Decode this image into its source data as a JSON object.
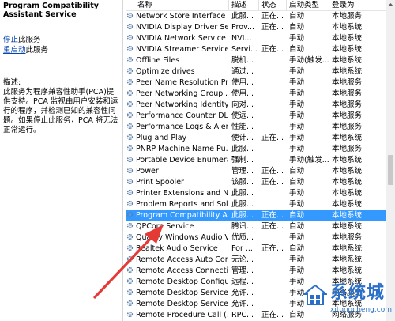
{
  "left_pane": {
    "service_title": "Program Compatibility Assistant Service",
    "actions": [
      {
        "link": "停止",
        "suffix": "此服务"
      },
      {
        "link": "重启动",
        "suffix": "此服务"
      }
    ],
    "description_label": "描述:",
    "description_text": "此服务为程序兼容性助手(PCA)提供支持。PCA 监视由用户安装和运行的程序，并检测已知的兼容性问题。如果停止此服务，PCA 将无法正常运行。"
  },
  "columns": {
    "name": "名称",
    "description": "描述",
    "status": "状态",
    "startup_type": "启动类型",
    "logon_as": "登录为"
  },
  "services": [
    {
      "name": "Network Store Interface ...",
      "description": "此服...",
      "status": "正在...",
      "startup": "自动",
      "logon": "本地服务"
    },
    {
      "name": "NVIDIA Display Driver Se...",
      "description": "Prov...",
      "status": "正在...",
      "startup": "自动",
      "logon": "本地系统"
    },
    {
      "name": "NVIDIA Network Service",
      "description": "NVI...",
      "status": "",
      "startup": "手动",
      "logon": "本地系统"
    },
    {
      "name": "NVIDIA Streamer Service",
      "description": "Servi...",
      "status": "正在...",
      "startup": "自动",
      "logon": "本地系统"
    },
    {
      "name": "Offline Files",
      "description": "脱机...",
      "status": "",
      "startup": "手动(触发...",
      "logon": "本地系统"
    },
    {
      "name": "Optimize drives",
      "description": "通过...",
      "status": "",
      "startup": "手动",
      "logon": "本地系统"
    },
    {
      "name": "Peer Name Resolution Pr...",
      "description": "使用...",
      "status": "",
      "startup": "手动",
      "logon": "本地服务"
    },
    {
      "name": "Peer Networking Groupi...",
      "description": "使用...",
      "status": "",
      "startup": "手动",
      "logon": "本地服务"
    },
    {
      "name": "Peer Networking Identity...",
      "description": "向对...",
      "status": "",
      "startup": "手动",
      "logon": "本地服务"
    },
    {
      "name": "Performance Counter DL...",
      "description": "使远...",
      "status": "",
      "startup": "手动",
      "logon": "本地服务"
    },
    {
      "name": "Performance Logs & Aler...",
      "description": "性能...",
      "status": "",
      "startup": "手动",
      "logon": "本地服务"
    },
    {
      "name": "Plug and Play",
      "description": "使计...",
      "status": "正在...",
      "startup": "手动",
      "logon": "本地系统"
    },
    {
      "name": "PNRP Machine Name Pu...",
      "description": "此服...",
      "status": "",
      "startup": "手动",
      "logon": "本地服务"
    },
    {
      "name": "Portable Device Enumera...",
      "description": "强制...",
      "status": "",
      "startup": "手动(触发...",
      "logon": "本地系统"
    },
    {
      "name": "Power",
      "description": "管理...",
      "status": "正在...",
      "startup": "自动",
      "logon": "本地系统"
    },
    {
      "name": "Print Spooler",
      "description": "该服...",
      "status": "正在...",
      "startup": "自动",
      "logon": "本地系统"
    },
    {
      "name": "Printer Extensions and N...",
      "description": "此服...",
      "status": "",
      "startup": "手动",
      "logon": "本地系统"
    },
    {
      "name": "Problem Reports and Sol...",
      "description": "此服...",
      "status": "",
      "startup": "手动",
      "logon": "本地系统"
    },
    {
      "name": "Program Compatibility A...",
      "description": "此服...",
      "status": "正在...",
      "startup": "自动",
      "logon": "本地系统",
      "selected": true
    },
    {
      "name": "QPCore Service",
      "description": "腾讯...",
      "status": "正在...",
      "startup": "自动",
      "logon": "本地系统"
    },
    {
      "name": "Quality Windows Audio V...",
      "description": "优质...",
      "status": "",
      "startup": "手动",
      "logon": "本地服务"
    },
    {
      "name": "Realtek Audio Service",
      "description": "For ...",
      "status": "正在...",
      "startup": "自动",
      "logon": "本地系统"
    },
    {
      "name": "Remote Access Auto Con...",
      "description": "无论...",
      "status": "",
      "startup": "手动",
      "logon": "本地系统"
    },
    {
      "name": "Remote Access Connecti...",
      "description": "管理...",
      "status": "",
      "startup": "手动",
      "logon": "本地系统"
    },
    {
      "name": "Remote Desktop Configu...",
      "description": "远程...",
      "status": "",
      "startup": "手动",
      "logon": "本地系统"
    },
    {
      "name": "Remote Desktop Services",
      "description": "允许...",
      "status": "",
      "startup": "手动",
      "logon": "网络服务"
    },
    {
      "name": "Remote Desktop Service...",
      "description": "允许...",
      "status": "",
      "startup": "手动",
      "logon": "本地系统"
    },
    {
      "name": "Remote Procedure Call (...",
      "description": "RPC...",
      "status": "正在...",
      "startup": "自动",
      "logon": "网络服务"
    }
  ],
  "watermark": {
    "brand": "系统城",
    "domain": "xitongcheng.com"
  },
  "icons": {
    "service_row": "gear-icon",
    "scroll_up": "scroll-up-arrow-icon"
  },
  "colors": {
    "selection": "#3399ff",
    "link": "#0645ad",
    "annotation_arrow": "#e53935",
    "watermark": "#2a70c9"
  }
}
